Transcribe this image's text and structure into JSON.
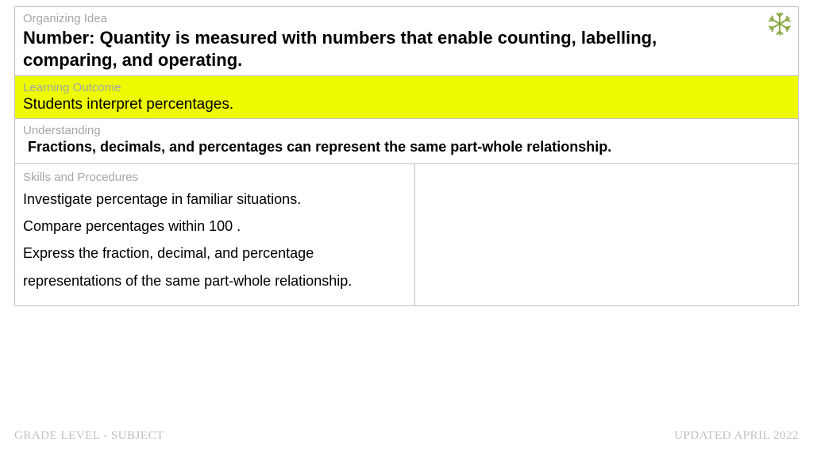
{
  "organizing_idea": {
    "label": "Organizing Idea",
    "title": "Number: Quantity is measured with numbers that enable counting, labelling, comparing, and operating."
  },
  "learning_outcome": {
    "label": "Learning Outcome",
    "text": "Students interpret percentages."
  },
  "understanding": {
    "label": "Understanding",
    "text": "Fractions, decimals, and percentages can represent the same part-whole relationship."
  },
  "skills": {
    "label": "Skills and Procedures",
    "items": [
      "Investigate percentage in familiar situations.",
      "Compare percentages within 100 .",
      "Express the fraction, decimal, and percentage representations of the same part-whole relationship."
    ]
  },
  "footer": {
    "left": "GRADE LEVEL - SUBJECT",
    "right": "UPDATED APRIL 2022"
  },
  "decor": {
    "icon_name": "snowflake-icon"
  }
}
